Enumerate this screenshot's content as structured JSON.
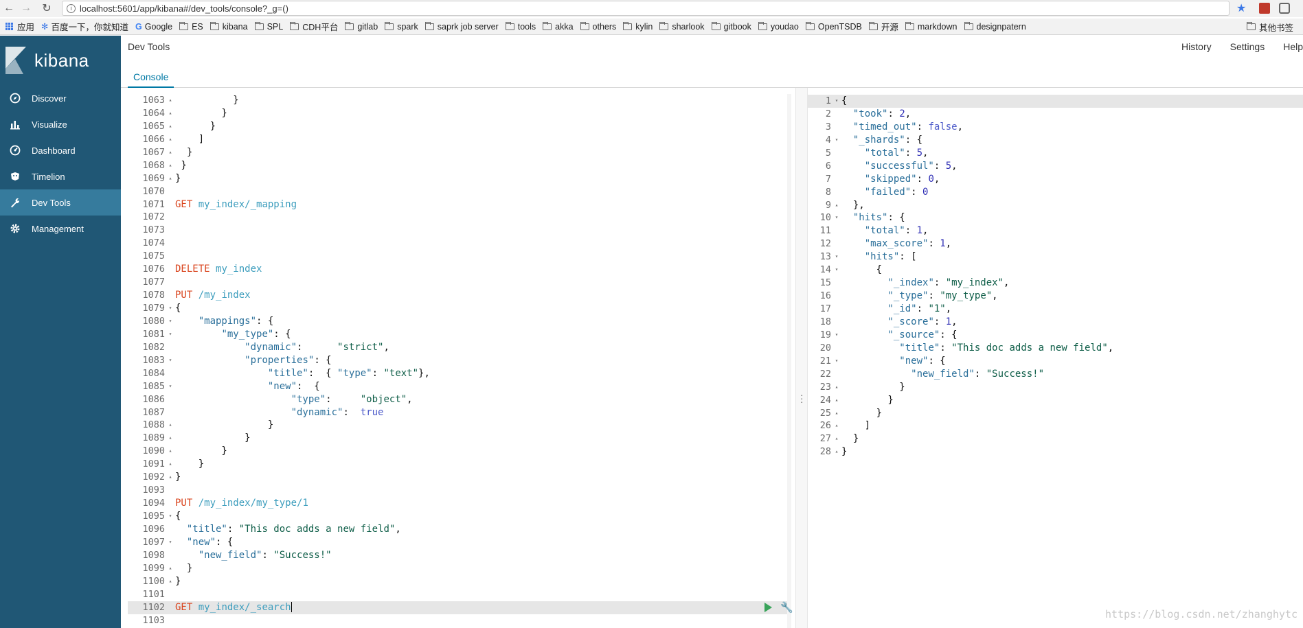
{
  "browser": {
    "url": "localhost:5601/app/kibana#/dev_tools/console?_g=()",
    "bookmarks": [
      "应用",
      "百度一下，你就知道",
      "Google",
      "ES",
      "kibana",
      "SPL",
      "CDH平台",
      "gitlab",
      "spark",
      "saprk job server",
      "tools",
      "akka",
      "others",
      "kylin",
      "sharlook",
      "gitbook",
      "youdao",
      "OpenTSDB",
      "开源",
      "markdown",
      "designpatern"
    ],
    "bookmarks_more": "其他书签"
  },
  "kibana": {
    "logo_text": "kibana",
    "nav": [
      {
        "label": "Discover",
        "icon": "compass-icon"
      },
      {
        "label": "Visualize",
        "icon": "bar-chart-icon"
      },
      {
        "label": "Dashboard",
        "icon": "dashboard-icon"
      },
      {
        "label": "Timelion",
        "icon": "timelion-icon"
      },
      {
        "label": "Dev Tools",
        "icon": "wrench-icon",
        "active": true
      },
      {
        "label": "Management",
        "icon": "gear-icon"
      }
    ],
    "header": {
      "title": "Dev Tools",
      "links": [
        "History",
        "Settings",
        "Help"
      ],
      "tab": "Console"
    }
  },
  "editor": {
    "lines": [
      {
        "n": "1063",
        "fold": "▴",
        "html": "<span class='p'>          }</span>"
      },
      {
        "n": "1064",
        "fold": "▴",
        "html": "<span class='p'>        }</span>"
      },
      {
        "n": "1065",
        "fold": "▴",
        "html": "<span class='p'>      }</span>"
      },
      {
        "n": "1066",
        "fold": "▴",
        "html": "<span class='p'>    ]</span>"
      },
      {
        "n": "1067",
        "fold": "▴",
        "html": "<span class='p'>  }</span>"
      },
      {
        "n": "1068",
        "fold": "▴",
        "html": "<span class='p'> }</span>"
      },
      {
        "n": "1069",
        "fold": "▴",
        "html": "<span class='p'>}</span>"
      },
      {
        "n": "1070",
        "fold": "",
        "html": ""
      },
      {
        "n": "1071",
        "fold": "",
        "html": "<span class='m'>GET</span> <span class='u'>my_index/_mapping</span>"
      },
      {
        "n": "1072",
        "fold": "",
        "html": ""
      },
      {
        "n": "1073",
        "fold": "",
        "html": ""
      },
      {
        "n": "1074",
        "fold": "",
        "html": ""
      },
      {
        "n": "1075",
        "fold": "",
        "html": ""
      },
      {
        "n": "1076",
        "fold": "",
        "html": "<span class='m'>DELETE</span> <span class='u'>my_index</span>"
      },
      {
        "n": "1077",
        "fold": "",
        "html": ""
      },
      {
        "n": "1078",
        "fold": "",
        "html": "<span class='m'>PUT</span> <span class='u'>/my_index</span>"
      },
      {
        "n": "1079",
        "fold": "▾",
        "html": "<span class='p'>{</span>"
      },
      {
        "n": "1080",
        "fold": "▾",
        "html": "    <span class='k'>\"mappings\"</span><span class='p'>: {</span>"
      },
      {
        "n": "1081",
        "fold": "▾",
        "html": "        <span class='k'>\"my_type\"</span><span class='p'>: {</span>"
      },
      {
        "n": "1082",
        "fold": "",
        "html": "            <span class='k'>\"dynamic\"</span><span class='p'>:      </span><span class='s'>\"strict\"</span><span class='p'>,</span>"
      },
      {
        "n": "1083",
        "fold": "▾",
        "html": "            <span class='k'>\"properties\"</span><span class='p'>: {</span>"
      },
      {
        "n": "1084",
        "fold": "",
        "html": "                <span class='k'>\"title\"</span><span class='p'>:  { </span><span class='k'>\"type\"</span><span class='p'>: </span><span class='s'>\"text\"</span><span class='p'>},</span>"
      },
      {
        "n": "1085",
        "fold": "▾",
        "html": "                <span class='k'>\"new\"</span><span class='p'>:  {</span>"
      },
      {
        "n": "1086",
        "fold": "",
        "html": "                    <span class='k'>\"type\"</span><span class='p'>:     </span><span class='s'>\"object\"</span><span class='p'>,</span>"
      },
      {
        "n": "1087",
        "fold": "",
        "html": "                    <span class='k'>\"dynamic\"</span><span class='p'>:  </span><span class='bl'>true</span>"
      },
      {
        "n": "1088",
        "fold": "▴",
        "html": "<span class='p'>                }</span>"
      },
      {
        "n": "1089",
        "fold": "▴",
        "html": "<span class='p'>            }</span>"
      },
      {
        "n": "1090",
        "fold": "▴",
        "html": "<span class='p'>        }</span>"
      },
      {
        "n": "1091",
        "fold": "▴",
        "html": "<span class='p'>    }</span>"
      },
      {
        "n": "1092",
        "fold": "▴",
        "html": "<span class='p'>}</span>"
      },
      {
        "n": "1093",
        "fold": "",
        "html": ""
      },
      {
        "n": "1094",
        "fold": "",
        "html": "<span class='m'>PUT</span> <span class='u'>/my_index/my_type/1</span>"
      },
      {
        "n": "1095",
        "fold": "▾",
        "html": "<span class='p'>{</span>"
      },
      {
        "n": "1096",
        "fold": "",
        "html": "  <span class='k'>\"title\"</span><span class='p'>: </span><span class='s'>\"This doc adds a new field\"</span><span class='p'>,</span>"
      },
      {
        "n": "1097",
        "fold": "▾",
        "html": "  <span class='k'>\"new\"</span><span class='p'>: {</span>"
      },
      {
        "n": "1098",
        "fold": "",
        "html": "    <span class='k'>\"new_field\"</span><span class='p'>: </span><span class='s'>\"Success!\"</span>"
      },
      {
        "n": "1099",
        "fold": "▴",
        "html": "<span class='p'>  }</span>"
      },
      {
        "n": "1100",
        "fold": "▴",
        "html": "<span class='p'>}</span>"
      },
      {
        "n": "1101",
        "fold": "",
        "html": ""
      },
      {
        "n": "1102",
        "fold": "",
        "html": "<span class='m'>GET</span> <span class='u'>my_index/_search</span><span class='cursor'></span>",
        "hl": true
      },
      {
        "n": "1103",
        "fold": "",
        "html": ""
      }
    ]
  },
  "output": {
    "lines": [
      {
        "n": "1",
        "fold": "▾",
        "html": "<span class='p'>{</span>",
        "hl": true
      },
      {
        "n": "2",
        "fold": "",
        "html": "  <span class='k'>\"took\"</span><span class='p'>: </span><span class='n'>2</span><span class='p'>,</span>"
      },
      {
        "n": "3",
        "fold": "",
        "html": "  <span class='k'>\"timed_out\"</span><span class='p'>: </span><span class='bl'>false</span><span class='p'>,</span>"
      },
      {
        "n": "4",
        "fold": "▾",
        "html": "  <span class='k'>\"_shards\"</span><span class='p'>: {</span>"
      },
      {
        "n": "5",
        "fold": "",
        "html": "    <span class='k'>\"total\"</span><span class='p'>: </span><span class='n'>5</span><span class='p'>,</span>"
      },
      {
        "n": "6",
        "fold": "",
        "html": "    <span class='k'>\"successful\"</span><span class='p'>: </span><span class='n'>5</span><span class='p'>,</span>"
      },
      {
        "n": "7",
        "fold": "",
        "html": "    <span class='k'>\"skipped\"</span><span class='p'>: </span><span class='n'>0</span><span class='p'>,</span>"
      },
      {
        "n": "8",
        "fold": "",
        "html": "    <span class='k'>\"failed\"</span><span class='p'>: </span><span class='n'>0</span>"
      },
      {
        "n": "9",
        "fold": "▴",
        "html": "<span class='p'>  },</span>"
      },
      {
        "n": "10",
        "fold": "▾",
        "html": "  <span class='k'>\"hits\"</span><span class='p'>: {</span>"
      },
      {
        "n": "11",
        "fold": "",
        "html": "    <span class='k'>\"total\"</span><span class='p'>: </span><span class='n'>1</span><span class='p'>,</span>"
      },
      {
        "n": "12",
        "fold": "",
        "html": "    <span class='k'>\"max_score\"</span><span class='p'>: </span><span class='n'>1</span><span class='p'>,</span>"
      },
      {
        "n": "13",
        "fold": "▾",
        "html": "    <span class='k'>\"hits\"</span><span class='p'>: [</span>"
      },
      {
        "n": "14",
        "fold": "▾",
        "html": "<span class='p'>      {</span>"
      },
      {
        "n": "15",
        "fold": "",
        "html": "        <span class='k'>\"_index\"</span><span class='p'>: </span><span class='s'>\"my_index\"</span><span class='p'>,</span>"
      },
      {
        "n": "16",
        "fold": "",
        "html": "        <span class='k'>\"_type\"</span><span class='p'>: </span><span class='s'>\"my_type\"</span><span class='p'>,</span>"
      },
      {
        "n": "17",
        "fold": "",
        "html": "        <span class='k'>\"_id\"</span><span class='p'>: </span><span class='s'>\"1\"</span><span class='p'>,</span>"
      },
      {
        "n": "18",
        "fold": "",
        "html": "        <span class='k'>\"_score\"</span><span class='p'>: </span><span class='n'>1</span><span class='p'>,</span>"
      },
      {
        "n": "19",
        "fold": "▾",
        "html": "        <span class='k'>\"_source\"</span><span class='p'>: {</span>"
      },
      {
        "n": "20",
        "fold": "",
        "html": "          <span class='k'>\"title\"</span><span class='p'>: </span><span class='s'>\"This doc adds a new field\"</span><span class='p'>,</span>"
      },
      {
        "n": "21",
        "fold": "▾",
        "html": "          <span class='k'>\"new\"</span><span class='p'>: {</span>"
      },
      {
        "n": "22",
        "fold": "",
        "html": "            <span class='k'>\"new_field\"</span><span class='p'>: </span><span class='s'>\"Success!\"</span>"
      },
      {
        "n": "23",
        "fold": "▴",
        "html": "<span class='p'>          }</span>"
      },
      {
        "n": "24",
        "fold": "▴",
        "html": "<span class='p'>        }</span>"
      },
      {
        "n": "25",
        "fold": "▴",
        "html": "<span class='p'>      }</span>"
      },
      {
        "n": "26",
        "fold": "▴",
        "html": "<span class='p'>    ]</span>"
      },
      {
        "n": "27",
        "fold": "▴",
        "html": "<span class='p'>  }</span>"
      },
      {
        "n": "28",
        "fold": "▴",
        "html": "<span class='p'>}</span>"
      }
    ]
  },
  "watermark": "https://blog.csdn.net/zhanghytc"
}
